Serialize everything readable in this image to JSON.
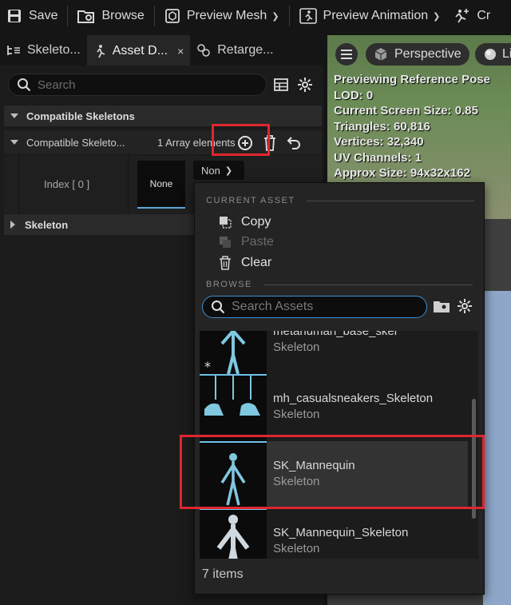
{
  "toolbar": {
    "save": "Save",
    "browse": "Browse",
    "preview_mesh": "Preview Mesh",
    "preview_animation": "Preview Animation",
    "create": "Cr"
  },
  "tabs": [
    {
      "label": "Skeleto..."
    },
    {
      "label": "Asset D...",
      "close": "×"
    },
    {
      "label": "Retarge..."
    }
  ],
  "details": {
    "search_placeholder": "Search",
    "section_compatible": "Compatible Skeletons",
    "prop_name": "Compatible Skeleto...",
    "prop_value": "1 Array elements",
    "index_label": "Index [ 0 ]",
    "thumb_none": "None",
    "combo_value": "Non",
    "section_skeleton": "Skeleton"
  },
  "viewport": {
    "perspective": "Perspective",
    "lit": "Li",
    "info": [
      "Previewing Reference Pose",
      "LOD: 0",
      "Current Screen Size: 0.85",
      "Triangles: 60,816",
      "Vertices: 32,340",
      "UV Channels: 1",
      "Approx Size: 94x32x162"
    ]
  },
  "menu": {
    "current_asset_heading": "CURRENT ASSET",
    "copy": "Copy",
    "paste": "Paste",
    "clear": "Clear",
    "browse_heading": "BROWSE",
    "search_placeholder": "Search Assets",
    "assets": [
      {
        "name": "metahuman_base_skel",
        "type": "Skeleton"
      },
      {
        "name": "mh_casualsneakers_Skeleton",
        "type": "Skeleton"
      },
      {
        "name": "SK_Mannequin",
        "type": "Skeleton"
      },
      {
        "name": "SK_Mannequin_Skeleton",
        "type": "Skeleton"
      }
    ],
    "item_count": "7 items"
  },
  "colors": {
    "highlight_red": "#e0262e",
    "accent_blue": "#3b8fd0"
  }
}
